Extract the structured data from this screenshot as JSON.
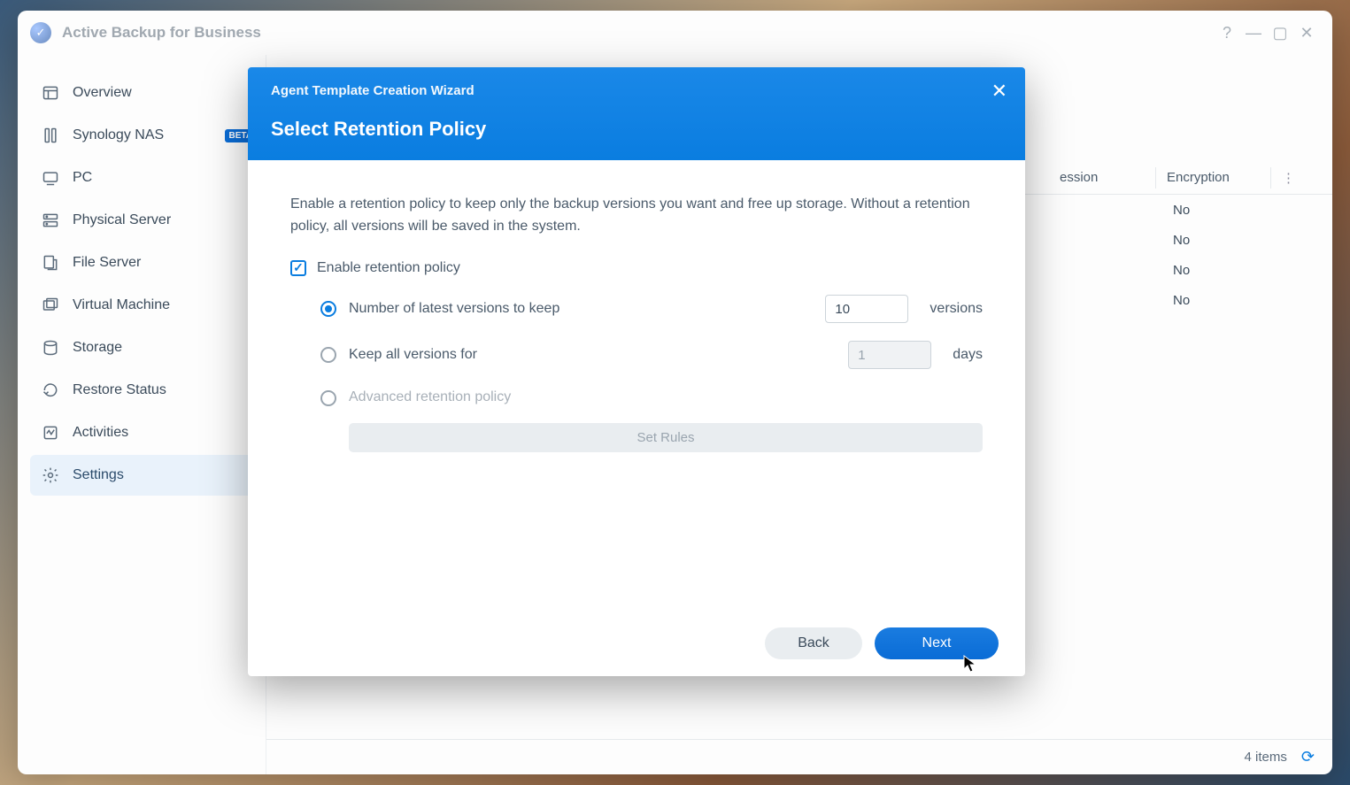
{
  "app": {
    "title": "Active Backup for Business"
  },
  "sidebar": {
    "items": [
      {
        "label": "Overview"
      },
      {
        "label": "Synology NAS",
        "badge": "BETA"
      },
      {
        "label": "PC"
      },
      {
        "label": "Physical Server"
      },
      {
        "label": "File Server"
      },
      {
        "label": "Virtual Machine"
      },
      {
        "label": "Storage"
      },
      {
        "label": "Restore Status"
      },
      {
        "label": "Activities"
      },
      {
        "label": "Settings"
      }
    ]
  },
  "table": {
    "headers": {
      "compression": "ession",
      "encryption": "Encryption"
    },
    "rows": [
      {
        "encryption": "No"
      },
      {
        "encryption": "No"
      },
      {
        "encryption": "No"
      },
      {
        "encryption": "No"
      }
    ]
  },
  "statusbar": {
    "count": "4 items"
  },
  "modal": {
    "wizard_title": "Agent Template Creation Wizard",
    "step_title": "Select Retention Policy",
    "description": "Enable a retention policy to keep only the backup versions you want and free up storage. Without a retention policy, all versions will be saved in the system.",
    "enable_label": "Enable retention policy",
    "options": {
      "versions": {
        "label": "Number of latest versions to keep",
        "value": "10",
        "unit": "versions"
      },
      "days": {
        "label": "Keep all versions for",
        "value": "1",
        "unit": "days"
      },
      "advanced": {
        "label": "Advanced retention policy",
        "button": "Set Rules"
      }
    },
    "buttons": {
      "back": "Back",
      "next": "Next"
    }
  }
}
